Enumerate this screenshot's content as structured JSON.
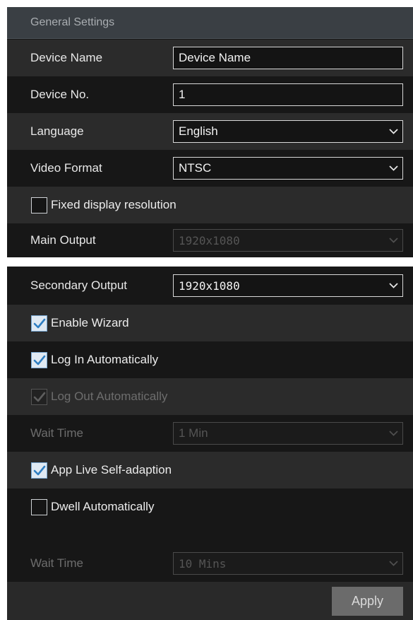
{
  "header": {
    "title": "General Settings"
  },
  "top_rows": {
    "device_name": {
      "label": "Device Name",
      "value": "Device Name"
    },
    "device_no": {
      "label": "Device No.",
      "value": "1"
    },
    "language": {
      "label": "Language",
      "value": "English"
    },
    "video_format": {
      "label": "Video Format",
      "value": "NTSC"
    },
    "fixed_display": {
      "label": "Fixed display resolution",
      "checked": false
    },
    "main_output": {
      "label": "Main Output",
      "value": "1920x1080",
      "disabled": true
    }
  },
  "bottom_rows": {
    "secondary_output": {
      "label": "Secondary Output",
      "value": "1920x1080"
    },
    "enable_wizard": {
      "label": "Enable Wizard",
      "checked": true
    },
    "log_in_auto": {
      "label": "Log In Automatically",
      "checked": true
    },
    "log_out_auto": {
      "label": "Log Out Automatically",
      "checked": true,
      "disabled": true
    },
    "wait_time_1": {
      "label": "Wait Time",
      "value": "1 Min",
      "disabled": true
    },
    "app_live": {
      "label": "App Live Self-adaption",
      "checked": true
    },
    "dwell_auto": {
      "label": "Dwell Automatically",
      "checked": false
    },
    "wait_time_2": {
      "label": "Wait Time",
      "value": "10 Mins",
      "disabled": true
    }
  },
  "footer": {
    "apply_label": "Apply"
  },
  "colors": {
    "panel_bg": "#171717",
    "alt_row_bg": "#2b2b2b",
    "header_bg": "#3a3f44",
    "check_color": "#2f7fc3",
    "apply_bg": "#6b6b6b"
  }
}
